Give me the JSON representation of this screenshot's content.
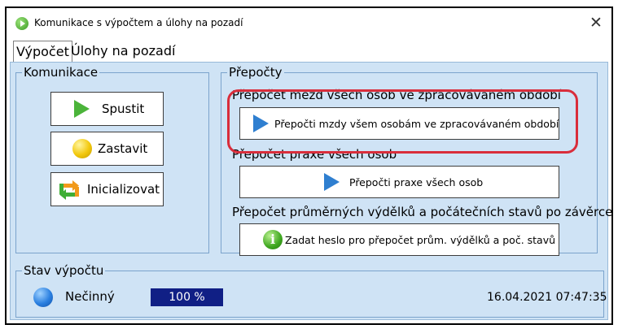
{
  "window": {
    "title": "Komunikace s výpočtem a úlohy na pozadí",
    "close_glyph": "✕"
  },
  "tabs": [
    {
      "label": "Výpočet",
      "active": true
    },
    {
      "label": "Úlohy na pozadí",
      "active": false
    }
  ],
  "komunikace": {
    "legend": "Komunikace",
    "buttons": [
      {
        "label": "Spustit",
        "icon": "play-green-icon"
      },
      {
        "label": "Zastavit",
        "icon": "yellow-ball-icon"
      },
      {
        "label": "Inicializovat",
        "icon": "refresh-arrows-icon"
      }
    ]
  },
  "prepocty": {
    "legend": "Přepočty",
    "sections": [
      {
        "title": "Přepočet mezd všech osob ve zpracovávaném období",
        "button": "Přepočti mzdy všem osobám ve zpracovávaném období",
        "icon": "play-blue-icon",
        "highlighted": true
      },
      {
        "title": "Přepočet praxe všech osob",
        "button": "Přepočti praxe všech osob",
        "icon": "play-blue-icon"
      },
      {
        "title": "Přepočet průměrných výdělků a počátečních stavů po závěrce",
        "button": "Zadat heslo pro přepočet prům. výdělků a poč. stavů",
        "icon": "info-icon"
      }
    ]
  },
  "stav": {
    "legend": "Stav výpočtu",
    "status": "Nečinný",
    "progress": "100 %",
    "progress_value": 1.0,
    "timestamp": "16.04.2021 07:47:35"
  },
  "colors": {
    "panel_bg": "#cfe3f5",
    "highlight": "#d92d3b",
    "progress_bar": "#101f85"
  }
}
